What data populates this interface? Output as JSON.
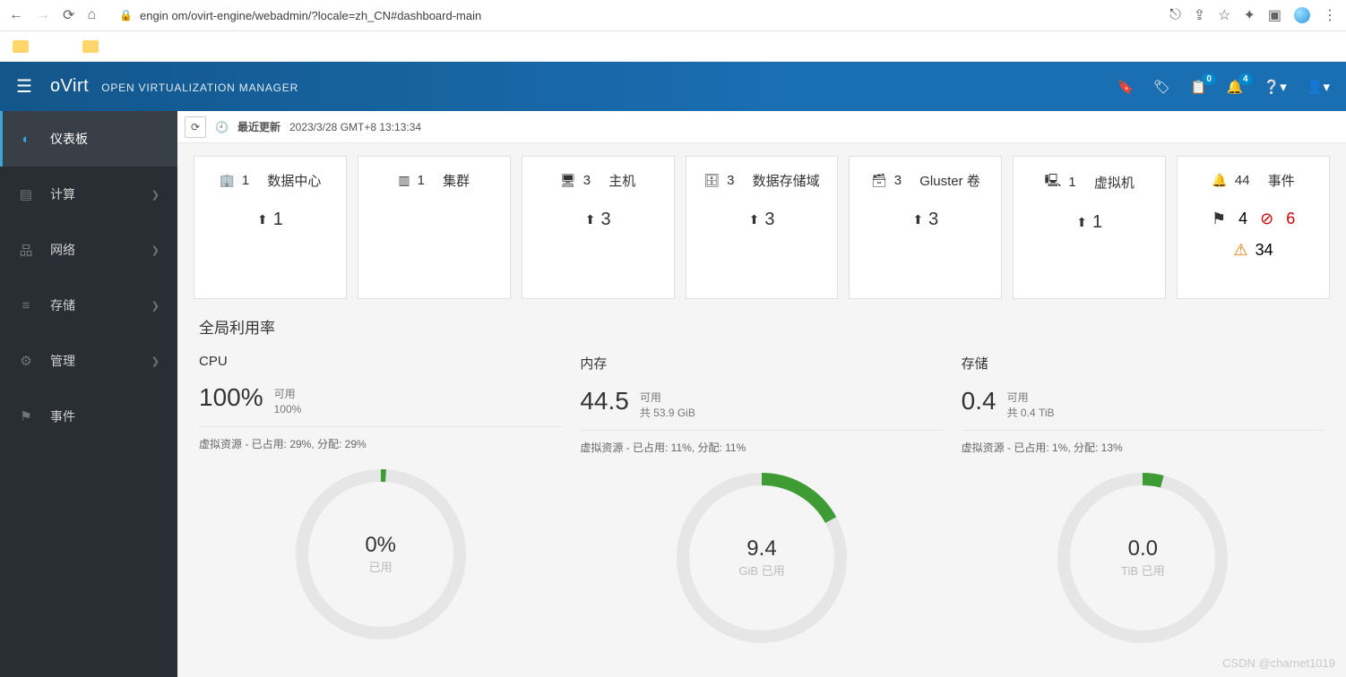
{
  "browser": {
    "url": "engin        om/ovirt-engine/webadmin/?locale=zh_CN#dashboard-main"
  },
  "header": {
    "logo": "oVirt",
    "subtitle": "OPEN VIRTUALIZATION MANAGER",
    "badge_tasks": "0",
    "badge_alerts": "4"
  },
  "sidebar": {
    "items": [
      {
        "label": "仪表板"
      },
      {
        "label": "计算"
      },
      {
        "label": "网络"
      },
      {
        "label": "存储"
      },
      {
        "label": "管理"
      },
      {
        "label": "事件"
      }
    ]
  },
  "refresh": {
    "label": "最近更新",
    "time": "2023/3/28 GMT+8 13:13:34"
  },
  "cards": [
    {
      "count": "1",
      "label": "数据中心",
      "stat": "1"
    },
    {
      "count": "1",
      "label": "集群",
      "stat": ""
    },
    {
      "count": "3",
      "label": "主机",
      "stat": "3"
    },
    {
      "count": "3",
      "label": "数据存储域",
      "stat": "3"
    },
    {
      "count": "3",
      "label": "Gluster 卷",
      "stat": "3"
    },
    {
      "count": "1",
      "label": "虚拟机",
      "stat": "1"
    }
  ],
  "events_card": {
    "count": "44",
    "label": "事件",
    "flag": "4",
    "error": "6",
    "warn": "34"
  },
  "utilization": {
    "title": "全局利用率",
    "cols": [
      {
        "name": "CPU",
        "big": "100%",
        "avail_label": "可用",
        "avail_detail": "100%",
        "detail": "虚拟资源 - 已占用: 29%, 分配: 29%",
        "donut_value": "0%",
        "donut_unit": "已用",
        "percent": 1
      },
      {
        "name": "内存",
        "big": "44.5",
        "avail_label": "可用",
        "avail_detail": "共 53.9 GiB",
        "detail": "虚拟资源 - 已占用: 11%, 分配: 11%",
        "donut_value": "9.4",
        "donut_unit": "GiB 已用",
        "percent": 17
      },
      {
        "name": "存储",
        "big": "0.4",
        "avail_label": "可用",
        "avail_detail": "共 0.4 TiB",
        "detail": "虚拟资源 - 已占用: 1%, 分配: 13%",
        "donut_value": "0.0",
        "donut_unit": "TiB 已用",
        "percent": 4
      }
    ]
  },
  "chart_data": [
    {
      "type": "pie",
      "title": "CPU",
      "series": [
        {
          "name": "已用",
          "values": [
            0
          ]
        },
        {
          "name": "可用",
          "values": [
            100
          ]
        }
      ],
      "unit": "%"
    },
    {
      "type": "pie",
      "title": "内存",
      "series": [
        {
          "name": "已用",
          "values": [
            9.4
          ]
        },
        {
          "name": "可用",
          "values": [
            44.5
          ]
        }
      ],
      "unit": "GiB",
      "total": 53.9
    },
    {
      "type": "pie",
      "title": "存储",
      "series": [
        {
          "name": "已用",
          "values": [
            0.0
          ]
        },
        {
          "name": "可用",
          "values": [
            0.4
          ]
        }
      ],
      "unit": "TiB",
      "total": 0.4
    }
  ],
  "watermark": "CSDN @charnet1019"
}
